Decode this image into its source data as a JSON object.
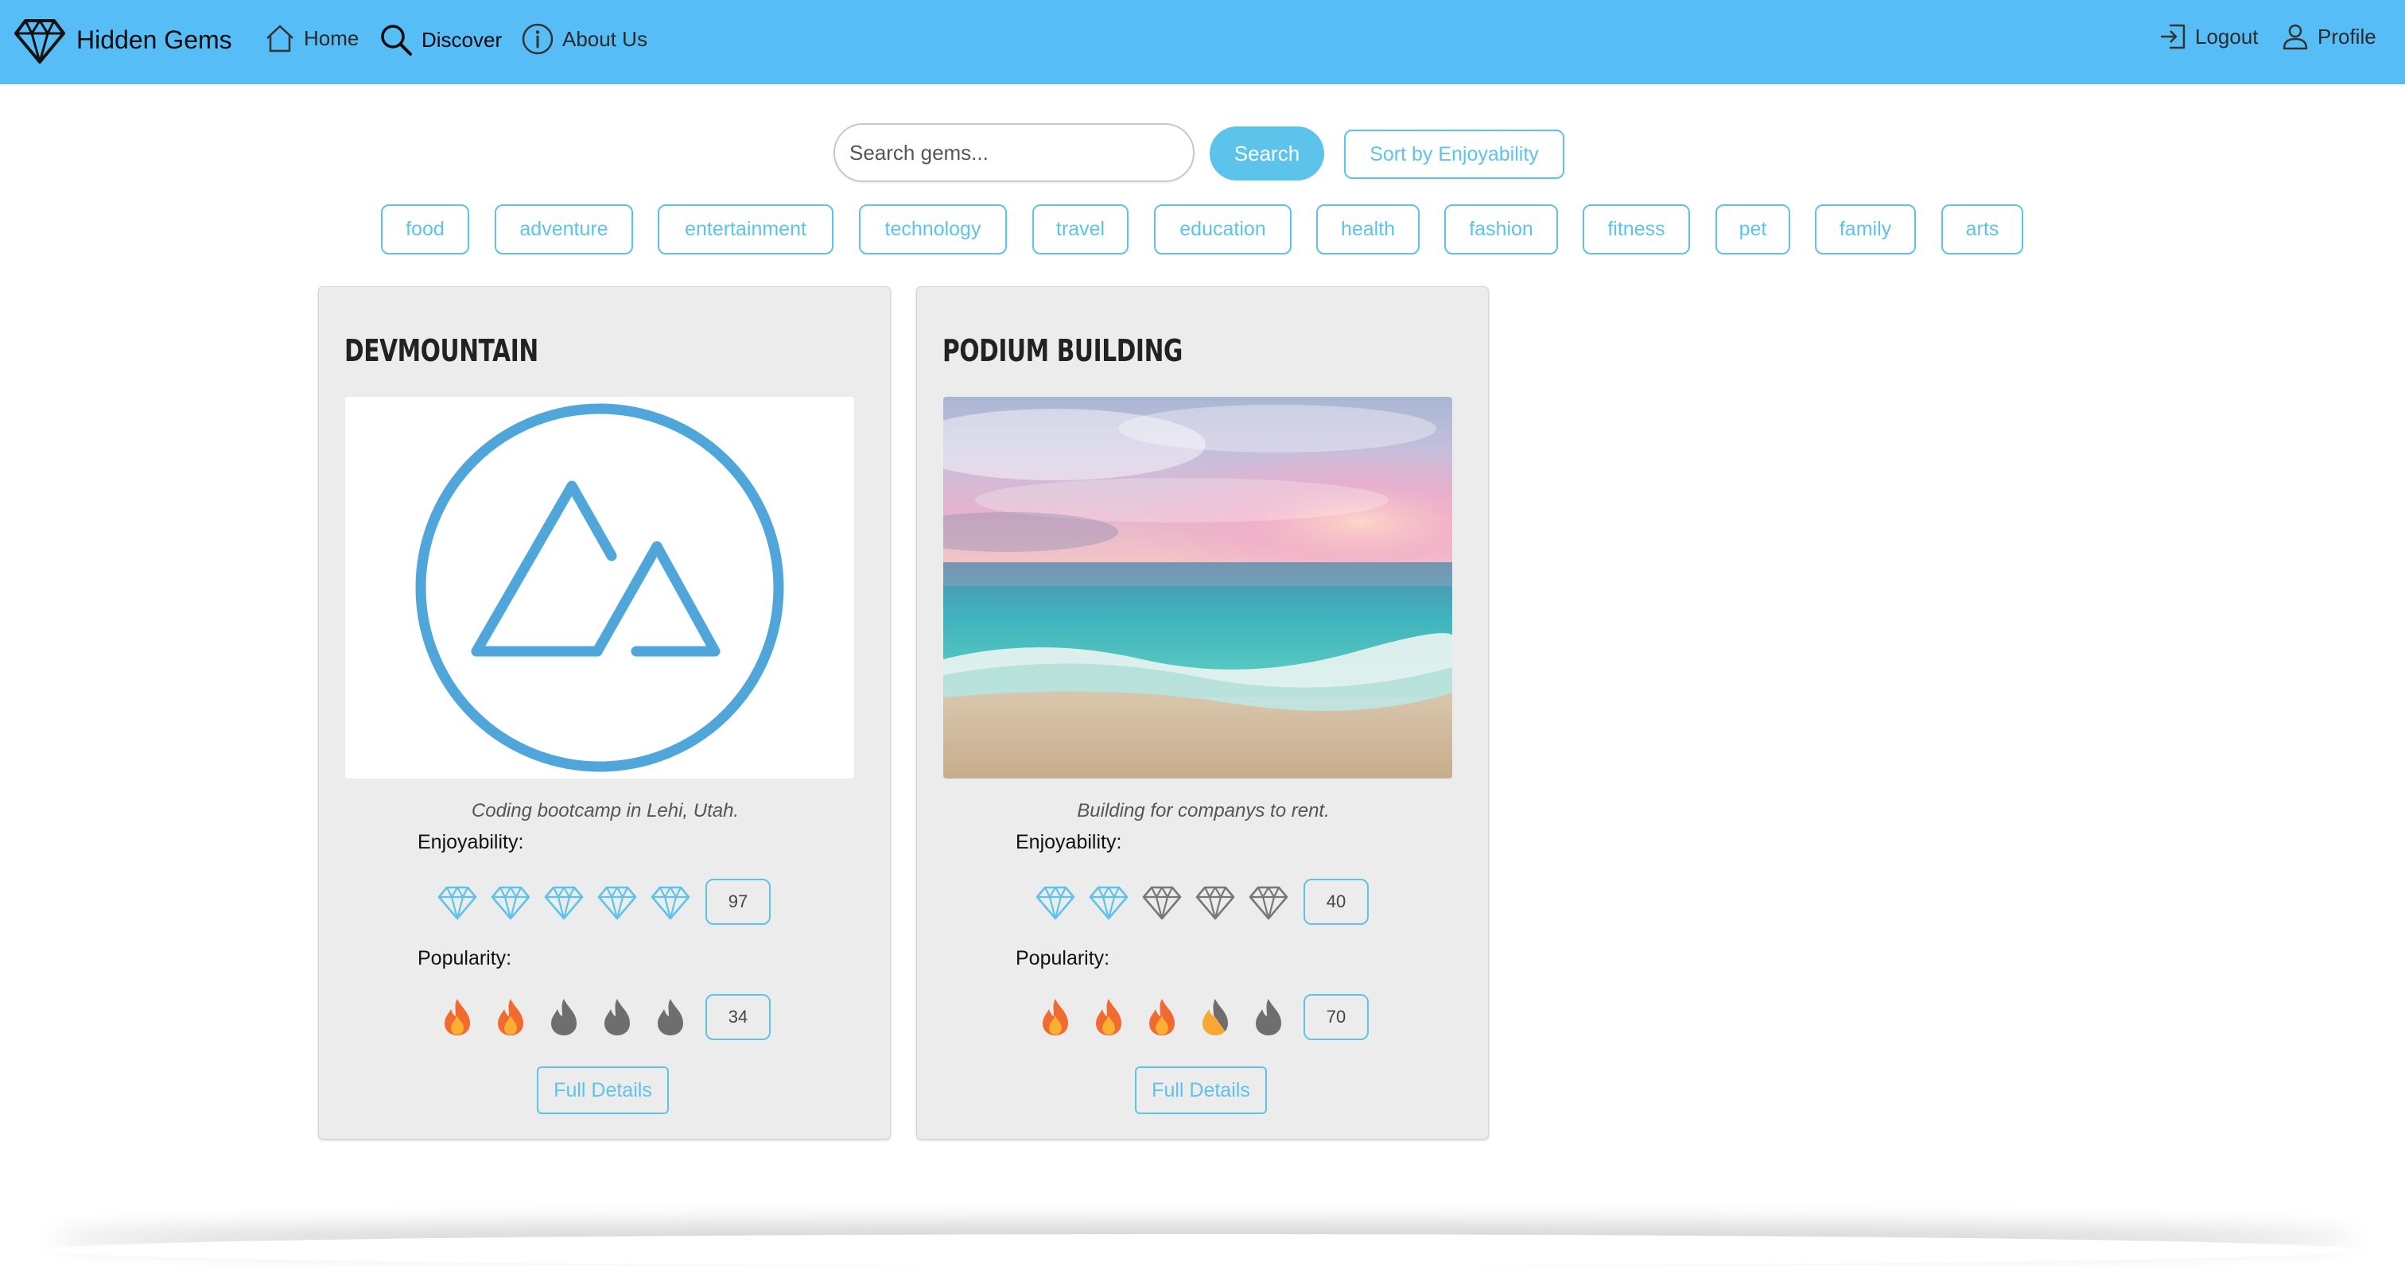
{
  "nav": {
    "brand": "Hidden Gems",
    "home": "Home",
    "discover": "Discover",
    "about": "About Us",
    "logout": "Logout",
    "profile": "Profile"
  },
  "search": {
    "placeholder": "Search gems...",
    "button": "Search",
    "sort_button": "Sort by Enjoyability"
  },
  "tags": [
    "food",
    "adventure",
    "entertainment",
    "technology",
    "travel",
    "education",
    "health",
    "fashion",
    "fitness",
    "pet",
    "family",
    "arts"
  ],
  "labels": {
    "enjoyability": "Enjoyability:",
    "popularity": "Popularity:",
    "details": "Full Details"
  },
  "cards": [
    {
      "title": "DEVMOUNTAIN",
      "description": "Coding bootcamp in Lehi, Utah.",
      "enjoyability": 97,
      "popularity": 34,
      "gems_filled": 5,
      "flames_filled": 2
    },
    {
      "title": "PODIUM BUILDING",
      "description": "Building for companys to rent.",
      "enjoyability": 40,
      "popularity": 70,
      "gems_filled": 2,
      "flames_filled": 3.5
    }
  ],
  "colors": {
    "navbar": "#56bdf6",
    "accent": "#5cc3ea",
    "card_bg": "#ececec",
    "gem_filled": "#5cc3ea",
    "gem_empty": "#777777",
    "flame_empty": "#6e6e6e"
  }
}
